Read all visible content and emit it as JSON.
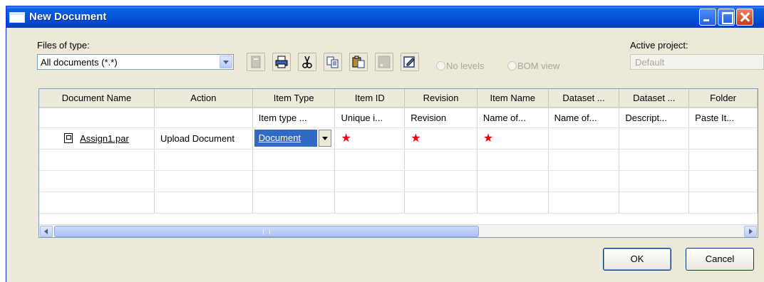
{
  "window": {
    "title": "New Document"
  },
  "toolbar": {
    "files_of_type_label": "Files of type:",
    "files_of_type_value": "All documents (*.*)",
    "active_project_label": "Active project:",
    "active_project_value": "Default",
    "radio_no_levels": "No levels",
    "radio_bom_view": "BOM view"
  },
  "table": {
    "columns": [
      "Document Name",
      "Action",
      "Item Type",
      "Item ID",
      "Revision",
      "Item Name",
      "Dataset ...",
      "Dataset ...",
      "Folder"
    ],
    "hints": [
      "",
      "",
      "Item type ...",
      "Unique i...",
      "Revision",
      "Name of...",
      "Name of...",
      "Descript...",
      "Paste It..."
    ],
    "row": {
      "document_name": "Assign1.par",
      "action": "Upload Document",
      "item_type": "Document",
      "required_marker": "★"
    }
  },
  "buttons": {
    "ok": "OK",
    "cancel": "Cancel"
  }
}
